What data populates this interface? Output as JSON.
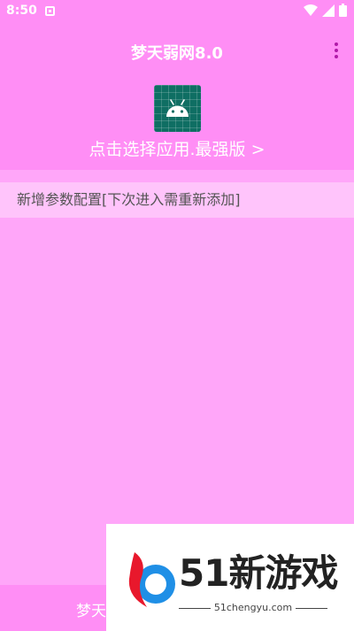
{
  "status_bar": {
    "time": "8:50",
    "icons": [
      "notification-icon",
      "wifi-icon",
      "signal-icon",
      "battery-icon"
    ]
  },
  "header": {
    "title": "梦天弱网8.0",
    "app_icon": "android-icon",
    "select_app_label": "点击选择应用.最强版 >"
  },
  "config": {
    "add_label": "新增参数配置[下次进入需重新添加]"
  },
  "bottom_bar": {
    "label": "梦天"
  },
  "watermark": {
    "brand": "51新游戏",
    "subtitle": "51chengyu.com"
  },
  "colors": {
    "header_bg": "#ff8ef5",
    "content_bg": "#ffa6f9",
    "row_bg": "#ffc4fb",
    "icon_bg": "#0f6e63"
  }
}
